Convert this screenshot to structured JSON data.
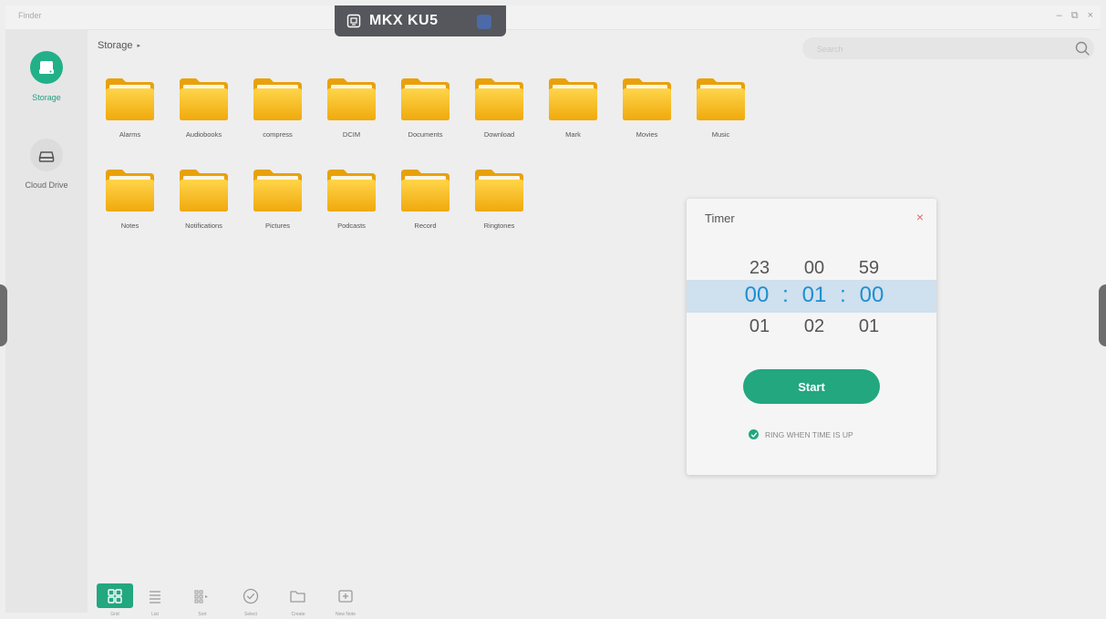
{
  "app": {
    "title": "Finder",
    "header_tag": "MKX KU5",
    "window_controls": {
      "minimize": "–",
      "restore": "⧉",
      "close": "×"
    }
  },
  "sidebar": {
    "items": [
      {
        "label": "Storage",
        "icon": "storage-drive-icon",
        "active": true
      },
      {
        "label": "Cloud Drive",
        "icon": "cloud-drive-icon",
        "active": false
      }
    ]
  },
  "breadcrumb": {
    "label": "Storage",
    "arrow": "▸"
  },
  "search": {
    "placeholder": "Search"
  },
  "folders": {
    "row1": [
      "Alarms",
      "Audiobooks",
      "compress",
      "DCIM",
      "Documents",
      "Download",
      "Mark",
      "Movies",
      "Music"
    ],
    "row2": [
      "Notes",
      "Notifications",
      "Pictures",
      "Podcasts",
      "Record",
      "Ringtones"
    ]
  },
  "timer": {
    "title": "Timer",
    "close_symbol": "×",
    "above": {
      "hours": "23",
      "minutes": "00",
      "seconds": "59"
    },
    "selected": {
      "hours": "00",
      "minutes": "01",
      "seconds": "00",
      "separator": ":"
    },
    "below": {
      "hours": "01",
      "minutes": "02",
      "seconds": "01"
    },
    "start_label": "Start",
    "ring_label": "RING WHEN TIME IS UP",
    "ring_checked": true
  },
  "toolbar": {
    "items": [
      {
        "label": "Grid",
        "icon": "grid-view-icon",
        "active": true
      },
      {
        "label": "List",
        "icon": "list-view-icon",
        "active": false
      },
      {
        "label": "Sort",
        "icon": "sort-icon",
        "active": false
      },
      {
        "label": "Select",
        "icon": "select-check-icon",
        "active": false
      },
      {
        "label": "Create",
        "icon": "new-folder-icon",
        "active": false
      },
      {
        "label": "New Note",
        "icon": "new-note-icon",
        "active": false
      }
    ]
  },
  "colors": {
    "accent": "#22a77f",
    "folder": "#f5b718",
    "selected_band": "#cfe0ee",
    "selected_text": "#1e8fd1",
    "close": "#e06a6a"
  }
}
